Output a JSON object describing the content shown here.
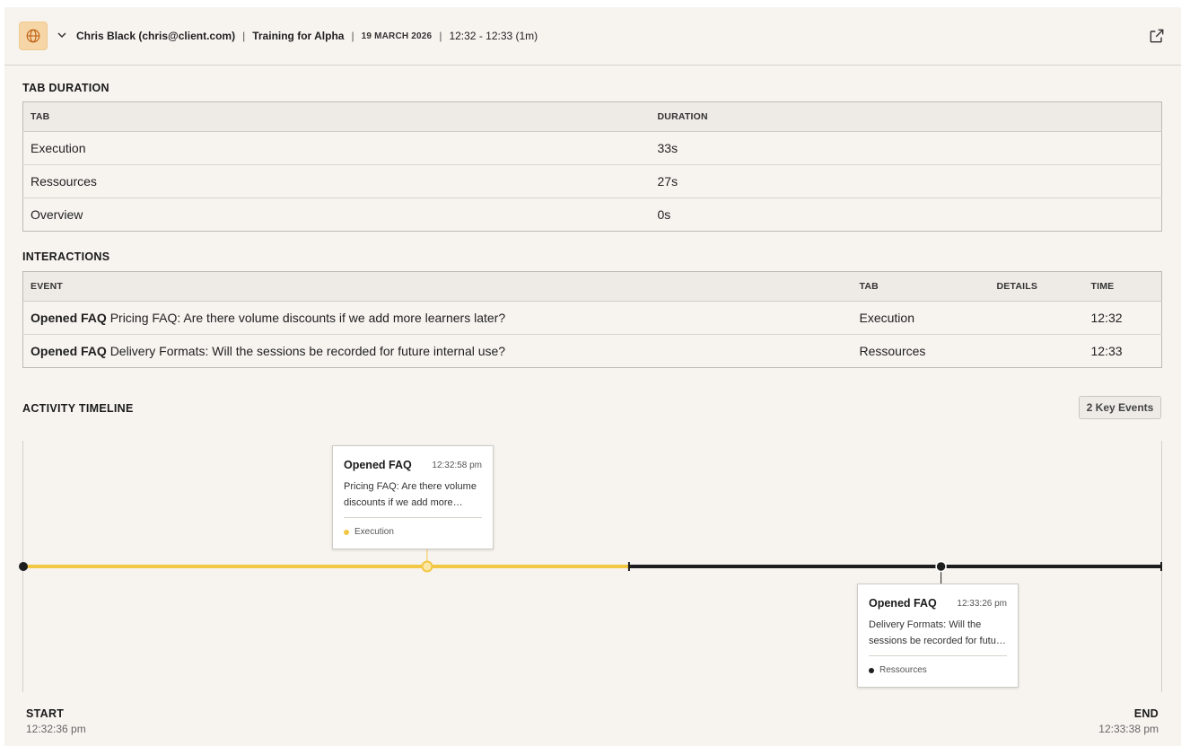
{
  "header": {
    "user": "Chris Black (chris@client.com)",
    "sep1": "|",
    "training": "Training for Alpha",
    "sep2": "|",
    "date": "19 MARCH 2026",
    "sep3": "|",
    "time_range": "12:32 - 12:33 (1m)"
  },
  "tab_duration": {
    "title": "TAB DURATION",
    "columns": [
      "TAB",
      "DURATION"
    ],
    "rows": [
      {
        "tab": "Execution",
        "duration": "33s"
      },
      {
        "tab": "Ressources",
        "duration": "27s"
      },
      {
        "tab": "Overview",
        "duration": "0s"
      }
    ]
  },
  "interactions": {
    "title": "INTERACTIONS",
    "columns": [
      "EVENT",
      "TAB",
      "DETAILS",
      "TIME"
    ],
    "rows": [
      {
        "event_type": "Opened FAQ",
        "event_text": "Pricing FAQ: Are there volume discounts if we add more learners later?",
        "tab": "Execution",
        "details": "",
        "time": "12:32"
      },
      {
        "event_type": "Opened FAQ",
        "event_text": "Delivery Formats: Will the sessions be recorded for future internal use?",
        "tab": "Ressources",
        "details": "",
        "time": "12:33"
      }
    ]
  },
  "timeline": {
    "title": "ACTIVITY TIMELINE",
    "key_events_label": "2 Key Events",
    "start_label": "START",
    "start_time": "12:32:36 pm",
    "end_label": "END",
    "end_time": "12:33:38 pm",
    "segments": [
      {
        "tab": "Execution",
        "from": "12:32:36",
        "to": "12:33:09",
        "color": "#f2c744"
      },
      {
        "tab": "Ressources",
        "from": "12:33:09",
        "to": "12:33:38",
        "color": "#1e1e1e"
      }
    ],
    "events": [
      {
        "title": "Opened FAQ",
        "time": "12:32:58 pm",
        "body_line1": "Pricing FAQ: Are there volume",
        "body_line2": "discounts if we add more…",
        "tab": "Execution",
        "color": "#f2c744"
      },
      {
        "title": "Opened FAQ",
        "time": "12:33:26 pm",
        "body_line1": "Delivery Formats: Will the",
        "body_line2": "sessions be recorded for futu…",
        "tab": "Ressources",
        "color": "#1e1e1e"
      }
    ]
  },
  "colors": {
    "accent": "#f2c744",
    "dark": "#1e1e1e",
    "globe_bg": "#f6d6a6"
  }
}
